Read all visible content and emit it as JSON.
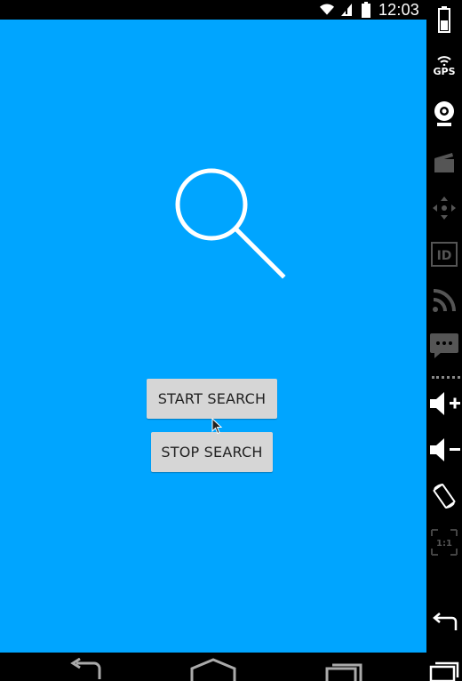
{
  "status_bar": {
    "time": "12:03",
    "icons": [
      "wifi-icon",
      "signal-icon",
      "battery-icon"
    ]
  },
  "app": {
    "background_color": "#00A5FF",
    "icon": "search-icon",
    "buttons": {
      "start_label": "START SEARCH",
      "stop_label": "STOP SEARCH"
    }
  },
  "nav_bar": {
    "icons": [
      "back-icon",
      "home-icon",
      "recent-apps-icon"
    ]
  },
  "side_toolbar": {
    "tools": [
      {
        "name": "battery-icon"
      },
      {
        "name": "gps-icon",
        "label": "GPS"
      },
      {
        "name": "camera-icon"
      },
      {
        "name": "video-clapper-icon"
      },
      {
        "name": "dpad-icon"
      },
      {
        "name": "id-icon",
        "label": "ID"
      },
      {
        "name": "rss-icon"
      },
      {
        "name": "sms-icon"
      },
      {
        "name": "volume-up-icon"
      },
      {
        "name": "volume-down-icon"
      },
      {
        "name": "rotate-icon"
      },
      {
        "name": "scale-icon",
        "label": "1:1"
      },
      {
        "name": "back-icon"
      },
      {
        "name": "recent-apps-icon"
      }
    ]
  }
}
